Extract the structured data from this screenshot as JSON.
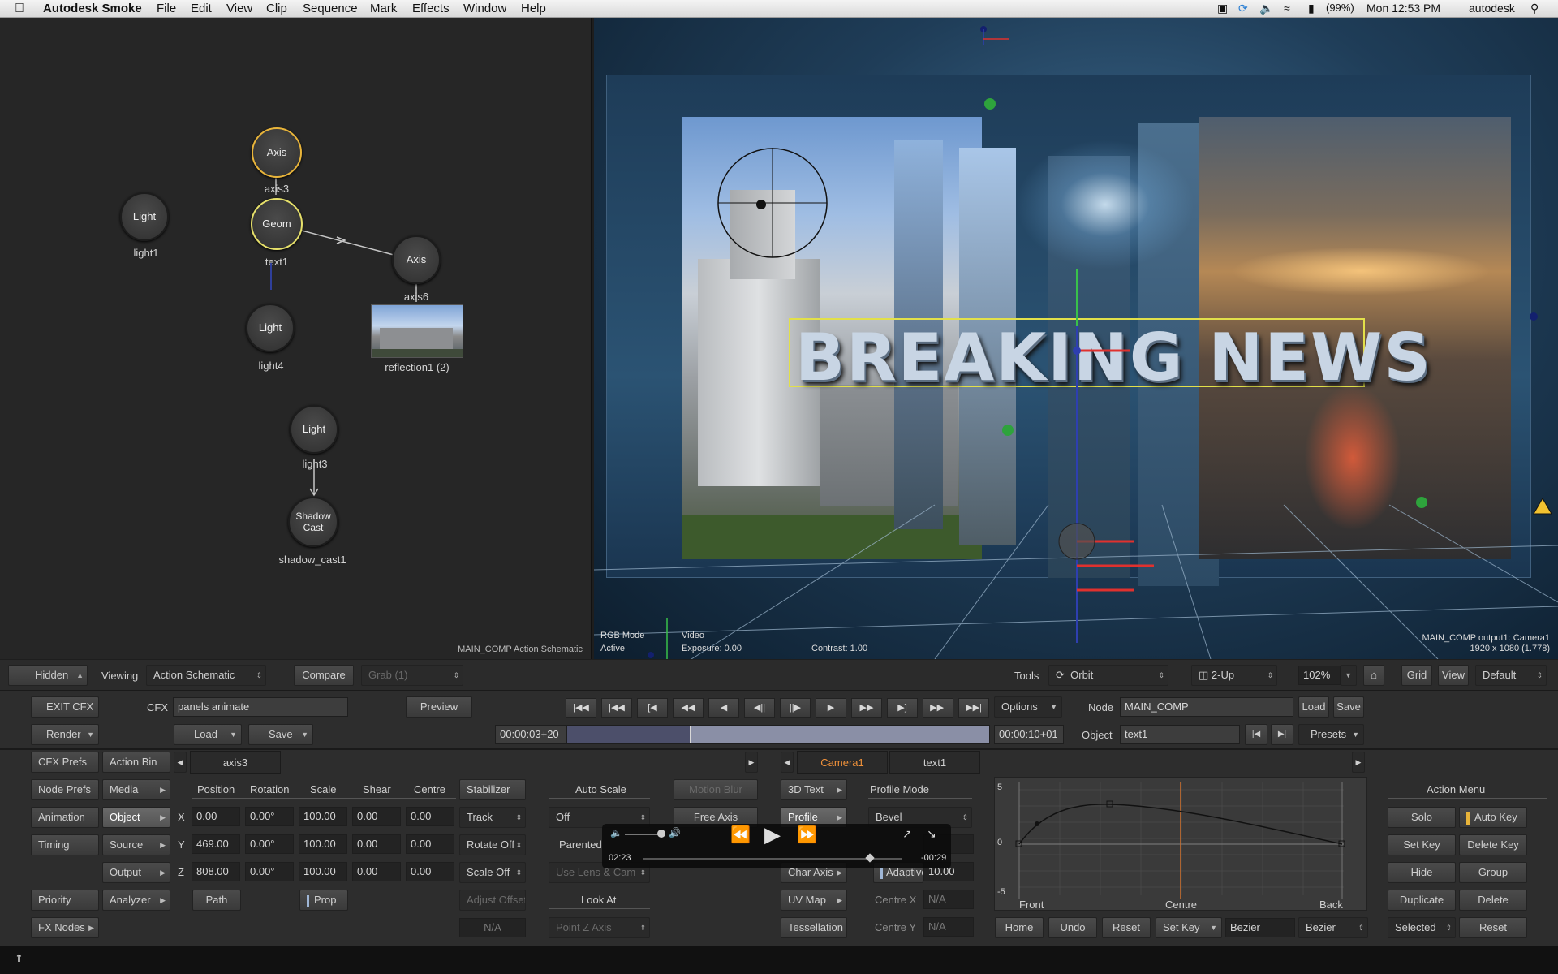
{
  "menubar": {
    "app_name": "Autodesk Smoke",
    "items": [
      "File",
      "Edit",
      "View",
      "Clip",
      "Sequence",
      "Mark",
      "Effects",
      "Window",
      "Help"
    ],
    "battery": "(99%)",
    "clock": "Mon 12:53 PM",
    "user": "autodesk"
  },
  "schematic": {
    "caption": "MAIN_COMP Action Schematic",
    "nodes": [
      {
        "type": "Axis",
        "label": "axis3"
      },
      {
        "type": "Geom",
        "label": "text1"
      },
      {
        "type": "Light",
        "label": "light1"
      },
      {
        "type": "Axis",
        "label": "axis6"
      },
      {
        "type": "Light",
        "label": "light4"
      },
      {
        "type": "reflection",
        "label": "reflection1 (2)"
      },
      {
        "type": "Light",
        "label": "light3"
      },
      {
        "type": "Shadow Cast",
        "label": "shadow_cast1"
      }
    ]
  },
  "viewer": {
    "headline": "BREAKING NEWS",
    "rgb_mode": "RGB Mode",
    "active": "Active",
    "video": "Video",
    "exposure": "Exposure: 0.00",
    "contrast": "Contrast: 1.00",
    "output_line1": "MAIN_COMP output1: Camera1",
    "output_line2": "1920 x 1080 (1.778)"
  },
  "topbar": {
    "hidden": "Hidden",
    "viewing_label": "Viewing",
    "viewing_value": "Action Schematic",
    "compare": "Compare",
    "grab": "Grab (1)",
    "tools_label": "Tools",
    "orbit": "Orbit",
    "layout": "2-Up",
    "zoom": "102%",
    "grid": "Grid",
    "view": "View",
    "default": "Default"
  },
  "left": {
    "exit_cfx": "EXIT CFX",
    "cfx_label": "CFX",
    "cfx_value": "panels animate",
    "preview": "Preview",
    "render": "Render",
    "load": "Load",
    "save": "Save",
    "cfx_prefs": "CFX Prefs",
    "action_bin": "Action Bin",
    "node_prefs": "Node Prefs",
    "media": "Media",
    "animation": "Animation",
    "object": "Object",
    "timing": "Timing",
    "source": "Source",
    "output": "Output",
    "priority": "Priority",
    "analyzer": "Analyzer",
    "fx_nodes": "FX Nodes",
    "tab_axis": "axis3"
  },
  "transport": {
    "timecode_in": "00:00:03+20",
    "timecode_out": "00:00:10+01",
    "options": "Options",
    "progress": 0.29
  },
  "node_info": {
    "node_label": "Node",
    "node_value": "MAIN_COMP",
    "load": "Load",
    "save": "Save",
    "object_label": "Object",
    "object_value": "text1",
    "presets": "Presets"
  },
  "transform": {
    "headers": [
      "Position",
      "Rotation",
      "Scale",
      "Shear",
      "Centre"
    ],
    "rows": [
      {
        "axis": "X",
        "values": [
          "0.00",
          "0.00°",
          "100.00",
          "0.00",
          "0.00"
        ]
      },
      {
        "axis": "Y",
        "values": [
          "469.00",
          "0.00°",
          "100.00",
          "0.00",
          "0.00"
        ]
      },
      {
        "axis": "Z",
        "values": [
          "808.00",
          "0.00°",
          "100.00",
          "0.00",
          "0.00"
        ]
      }
    ],
    "path": "Path",
    "prop": "Prop",
    "stabilizer": "Stabilizer",
    "track": "Track",
    "rotate_off": "Rotate Off",
    "scale_off": "Scale Off",
    "adjust_offset": "Adjust Offset",
    "na": "N/A"
  },
  "mid": {
    "auto_scale": "Auto Scale",
    "off": "Off",
    "parented": "Parented",
    "use_lens": "Use Lens & Cam",
    "look_at": "Look At",
    "point_z": "Point Z Axis",
    "motion_blur": "Motion Blur",
    "free_axis": "Free Axis"
  },
  "text3d": {
    "tab_camera": "Camera1",
    "tab_text": "text1",
    "text_3d": "3D Text",
    "profile": "Profile",
    "char_axis": "Char Axis",
    "uv_map": "UV Map",
    "tessellation": "Tessellation",
    "profile_mode": "Profile Mode",
    "bevel": "Bevel",
    "adaptive": "Adaptive",
    "adaptive_value": "10.00",
    "centre_x": "Centre X",
    "centre_y": "Centre Y",
    "na": "N/A"
  },
  "graph": {
    "y_top": "5",
    "y_mid": "0",
    "y_bot": "-5",
    "front": "Front",
    "centre": "Centre",
    "back": "Back",
    "home": "Home",
    "undo": "Undo",
    "reset": "Reset",
    "set_key": "Set Key",
    "bezier1": "Bezier",
    "bezier2": "Bezier"
  },
  "action_menu": {
    "title": "Action Menu",
    "solo": "Solo",
    "auto_key": "Auto Key",
    "set_key": "Set Key",
    "delete_key": "Delete Key",
    "hide": "Hide",
    "group": "Group",
    "duplicate": "Duplicate",
    "delete": "Delete",
    "selected": "Selected",
    "reset": "Reset"
  },
  "popup": {
    "elapsed": "02:23",
    "remaining": "-00:29"
  }
}
